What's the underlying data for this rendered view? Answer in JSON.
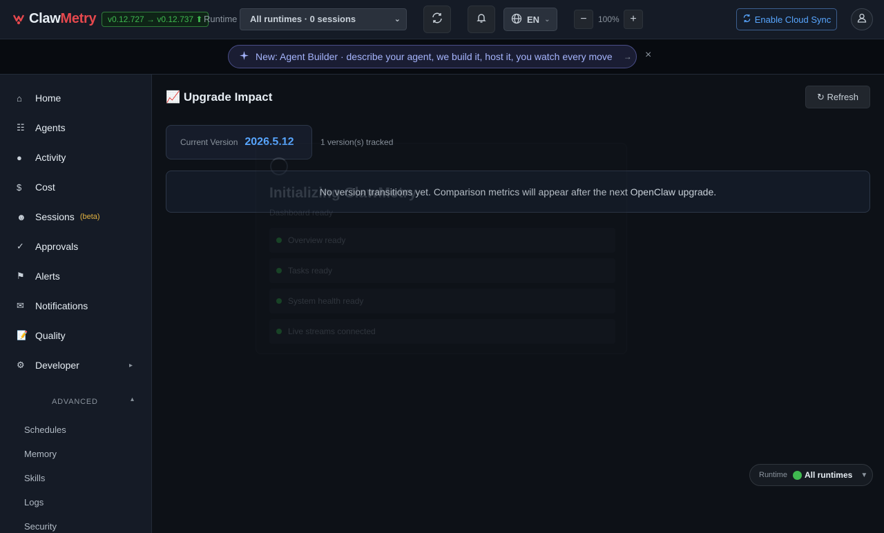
{
  "app": {
    "logo_part1": "Claw",
    "logo_part2": "Metry",
    "version_badge": "v0.12.727 → v0.12.737 ⬆"
  },
  "topbar": {
    "runtime_label": "Runtime",
    "runtime_select_value": "All runtimes · 0 sessions",
    "language": "EN",
    "zoom_minus": "−",
    "zoom_level": "100%",
    "zoom_plus": "+",
    "cloud_sync_label": "Enable Cloud Sync"
  },
  "banner": {
    "text": "New: Agent Builder · describe your agent, we build it, host it, you watch every move",
    "arrow": "→",
    "close": "×"
  },
  "sidebar": {
    "items": [
      {
        "icon": "⌂",
        "label": "Home"
      },
      {
        "icon": "☷",
        "label": "Agents"
      },
      {
        "icon": "●",
        "label": "Activity"
      },
      {
        "icon": "$",
        "label": "Cost"
      },
      {
        "icon": "☻",
        "label": "Sessions",
        "badge": "(beta)"
      },
      {
        "icon": "✓",
        "label": "Approvals"
      },
      {
        "icon": "⚑",
        "label": "Alerts"
      },
      {
        "icon": "✉",
        "label": "Notifications"
      },
      {
        "icon": "📝",
        "label": "Quality"
      },
      {
        "icon": "⚙",
        "label": "Developer",
        "chevron": "▸"
      }
    ],
    "advanced_header": "ADVANCED",
    "advanced_caret": "▴",
    "advanced_items": [
      "Schedules",
      "Memory",
      "Skills",
      "Logs",
      "Security"
    ]
  },
  "main": {
    "title": "📈 Upgrade Impact",
    "refresh_label": "↻ Refresh",
    "current_version_label": "Current Version",
    "current_version_value": "2026.5.12",
    "tracked_text": "1 version(s) tracked",
    "empty_message": "No version transitions yet. Comparison metrics will appear after the next OpenClaw upgrade."
  },
  "loader": {
    "title": "Initializing ClawMetry",
    "subtitle": "Dashboard ready",
    "steps": [
      "Overview ready",
      "Tasks ready",
      "System health ready",
      "Live streams connected"
    ]
  },
  "runtime_pill": {
    "label": "Runtime",
    "value": "All runtimes",
    "caret": "▼"
  },
  "colors": {
    "accent_blue": "#58a6ff",
    "brand_red": "#e5484d",
    "success_green": "#3fb950",
    "beta_yellow": "#e3b341"
  }
}
